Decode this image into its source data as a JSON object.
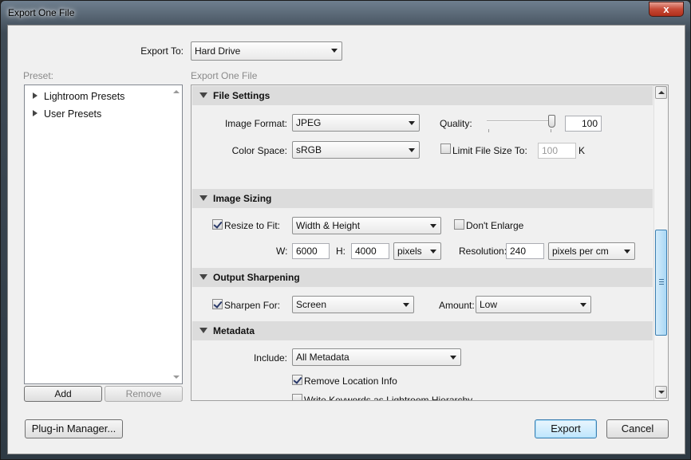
{
  "window": {
    "title": "Export One File",
    "close_glyph": "x"
  },
  "export_to": {
    "label": "Export To:",
    "value": "Hard Drive"
  },
  "preset": {
    "label": "Preset:",
    "items": [
      "Lightroom Presets",
      "User Presets"
    ],
    "add_label": "Add",
    "remove_label": "Remove"
  },
  "panel": {
    "title": "Export One File",
    "file_settings": {
      "header": "File Settings",
      "image_format_label": "Image Format:",
      "image_format_value": "JPEG",
      "quality_label": "Quality:",
      "quality_value": "100",
      "quality_fraction": 1.0,
      "color_space_label": "Color Space:",
      "color_space_value": "sRGB",
      "limit_label": "Limit File Size To:",
      "limit_value": "100",
      "limit_unit": "K",
      "limit_checked": false
    },
    "image_sizing": {
      "header": "Image Sizing",
      "resize_label": "Resize to Fit:",
      "resize_checked": true,
      "resize_value": "Width & Height",
      "dont_enlarge_label": "Don't Enlarge",
      "dont_enlarge_checked": false,
      "w_label": "W:",
      "w_value": "6000",
      "h_label": "H:",
      "h_value": "4000",
      "unit_value": "pixels",
      "resolution_label": "Resolution:",
      "resolution_value": "240",
      "resolution_unit": "pixels per cm"
    },
    "output_sharpening": {
      "header": "Output Sharpening",
      "sharpen_label": "Sharpen For:",
      "sharpen_checked": true,
      "sharpen_value": "Screen",
      "amount_label": "Amount:",
      "amount_value": "Low"
    },
    "metadata": {
      "header": "Metadata",
      "include_label": "Include:",
      "include_value": "All Metadata",
      "remove_location_label": "Remove Location Info",
      "remove_location_checked": true,
      "write_keywords_label": "Write Keywords as Lightroom Hierarchy",
      "write_keywords_checked": false
    }
  },
  "footer": {
    "plugin_manager_label": "Plug-in Manager...",
    "export_label": "Export",
    "cancel_label": "Cancel"
  },
  "icons": {
    "tree_expand": "triangle-right-icon",
    "section_collapse": "triangle-down-icon",
    "dropdown": "chevron-down-icon"
  }
}
